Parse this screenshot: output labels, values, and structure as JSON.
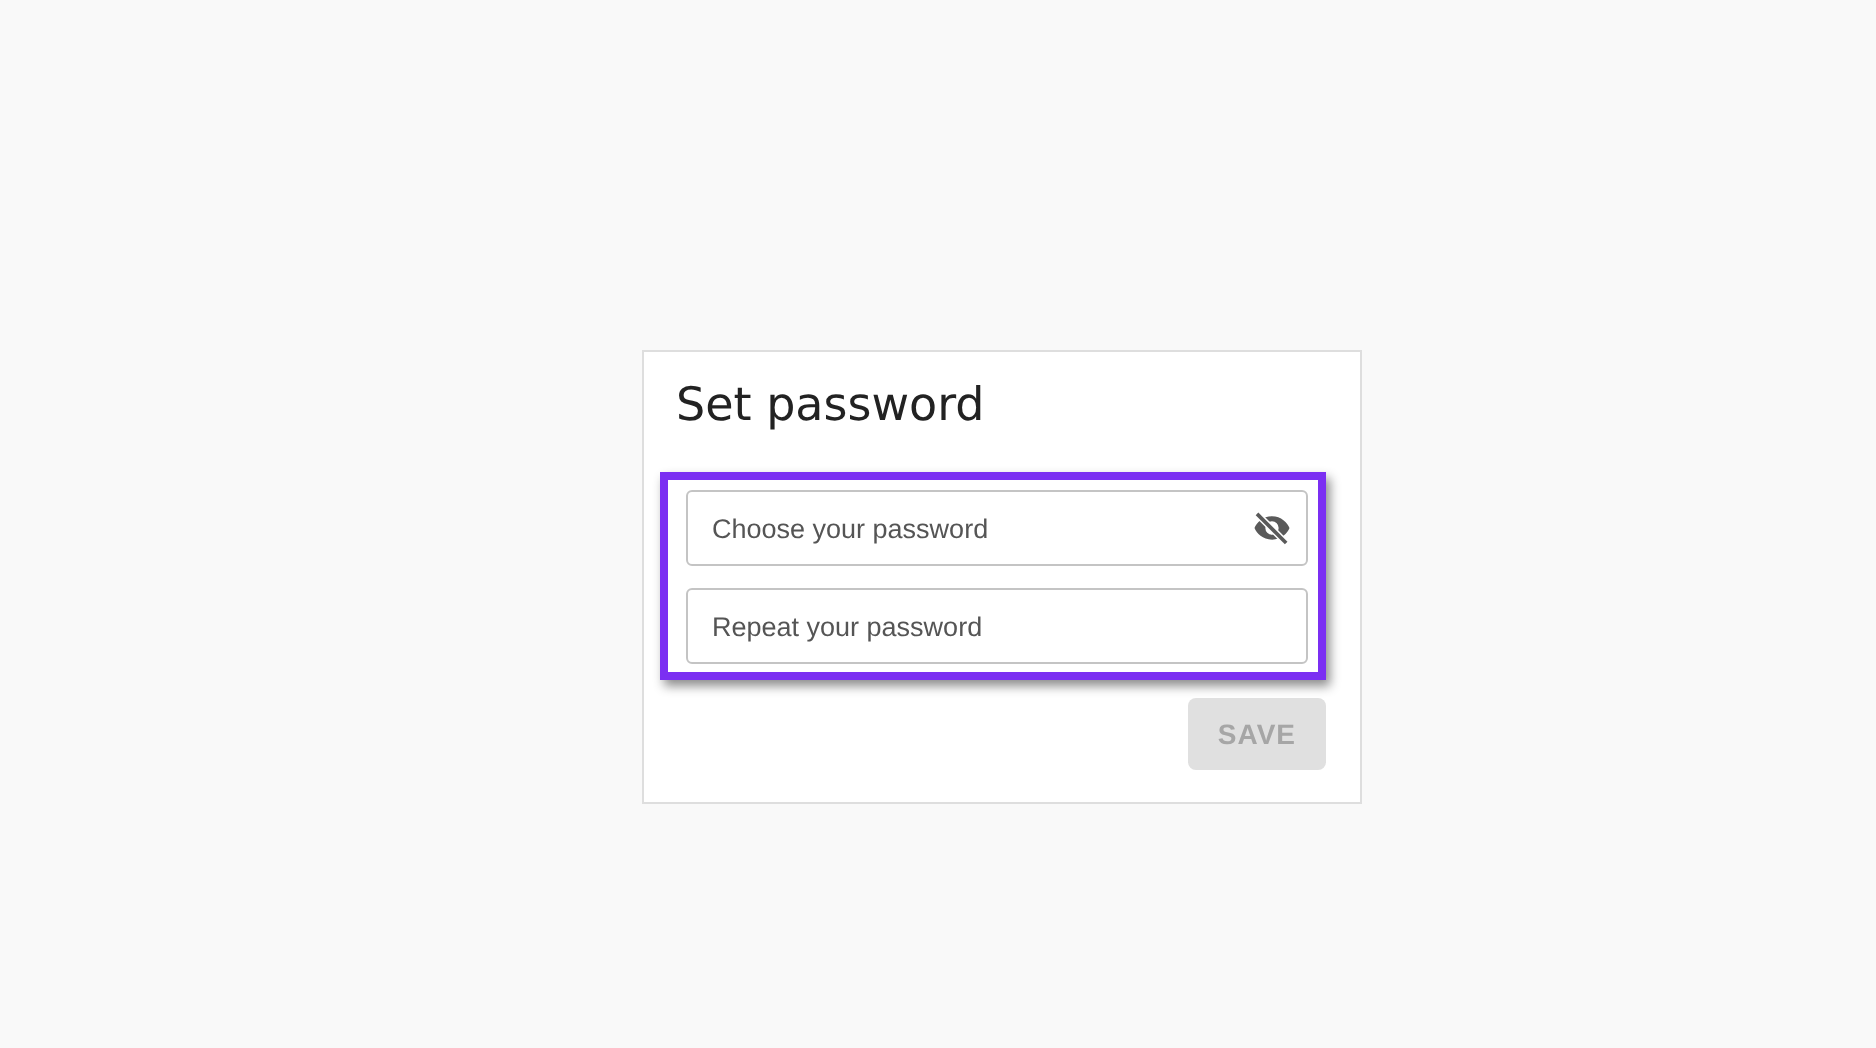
{
  "dialog": {
    "title": "Set password",
    "fields_highlighted": true,
    "fields": [
      {
        "kind": "password_with_toggle",
        "placeholder": "Choose your password"
      },
      {
        "kind": "password",
        "placeholder": "Repeat your password"
      }
    ],
    "save_button": {
      "label": "SAVE",
      "disabled": true
    }
  }
}
